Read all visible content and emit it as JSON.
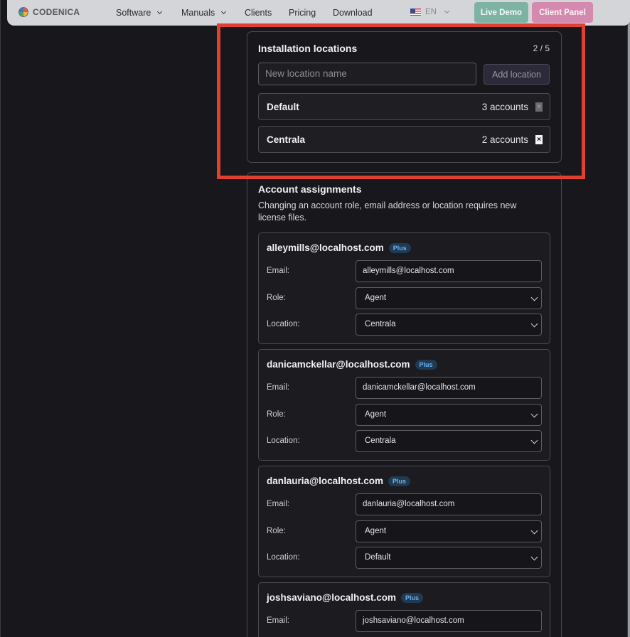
{
  "header": {
    "brand": "CODENICA",
    "nav": [
      "Software",
      "Manuals",
      "Clients",
      "Pricing",
      "Download"
    ],
    "lang": "EN",
    "live_demo": "Live Demo",
    "client_panel": "Client Panel",
    "colors": {
      "live_demo": "#7eb3a3",
      "client_panel": "#d48aae",
      "highlight": "#e0402f"
    }
  },
  "locations": {
    "title": "Installation locations",
    "counter": "2 / 5",
    "input_placeholder": "New location name",
    "add_label": "Add location",
    "items": [
      {
        "name": "Default",
        "count": "3 accounts",
        "delete": "×"
      },
      {
        "name": "Centrala",
        "count": "2 accounts",
        "delete": "×"
      }
    ]
  },
  "accounts": {
    "title": "Account assignments",
    "description": "Changing an account role, email address or location requires new license files.",
    "labels": {
      "email": "Email:",
      "role": "Role:",
      "location": "Location:"
    },
    "items": [
      {
        "email": "alleymills@localhost.com",
        "badge": "Plus",
        "role": "Agent",
        "location": "Centrala"
      },
      {
        "email": "danicamckellar@localhost.com",
        "badge": "Plus",
        "role": "Agent",
        "location": "Centrala"
      },
      {
        "email": "danlauria@localhost.com",
        "badge": "Plus",
        "role": "Agent",
        "location": "Default"
      },
      {
        "email": "joshsaviano@localhost.com",
        "badge": "Plus",
        "role": "",
        "location": ""
      }
    ]
  }
}
